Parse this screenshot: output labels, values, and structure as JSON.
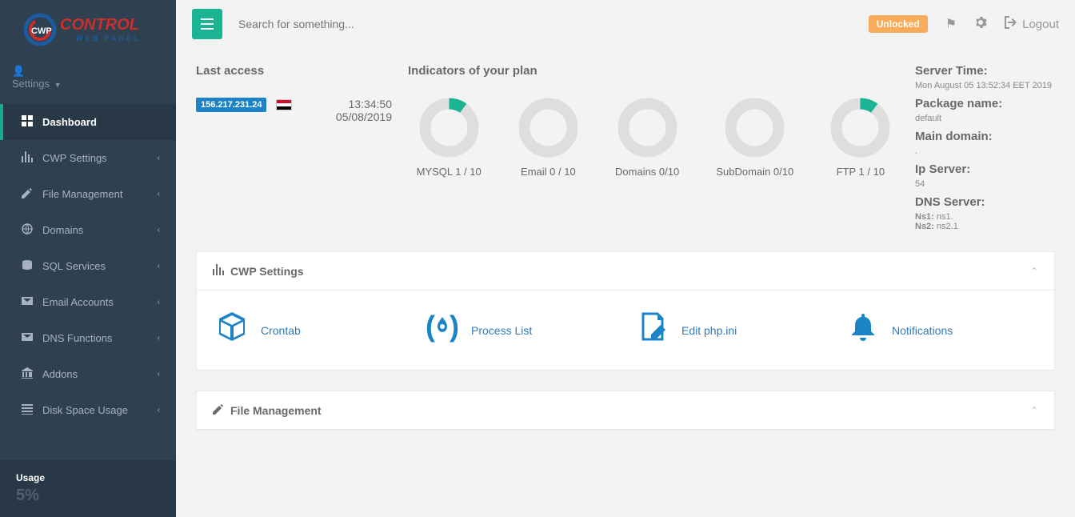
{
  "logo": {
    "top": "CWP",
    "main": "CONTROL",
    "sub": "WEB PANEL"
  },
  "settings_label": "Settings",
  "nav": [
    {
      "label": "Dashboard",
      "active": true,
      "icon": "grid"
    },
    {
      "label": "CWP Settings",
      "icon": "chart"
    },
    {
      "label": "File Management",
      "icon": "edit"
    },
    {
      "label": "Domains",
      "icon": "globe"
    },
    {
      "label": "SQL Services",
      "icon": "db"
    },
    {
      "label": "Email Accounts",
      "icon": "mail"
    },
    {
      "label": "DNS Functions",
      "icon": "mail"
    },
    {
      "label": "Addons",
      "icon": "bank"
    },
    {
      "label": "Disk Space Usage",
      "icon": "list"
    }
  ],
  "usage": {
    "label": "Usage",
    "percent": "5%"
  },
  "search": {
    "placeholder": "Search for something..."
  },
  "unlocked": "Unlocked",
  "logout": "Logout",
  "last_access": {
    "title": "Last access",
    "ip": "156.217.231.24",
    "time": "13:34:50",
    "date": "05/08/2019"
  },
  "indicators": {
    "title": "Indicators of your plan",
    "items": [
      {
        "label": "MYSQL 1 / 10",
        "used": 1,
        "total": 10
      },
      {
        "label": "Email 0 / 10",
        "used": 0,
        "total": 10
      },
      {
        "label": "Domains 0/10",
        "used": 0,
        "total": 10
      },
      {
        "label": "SubDomain 0/10",
        "used": 0,
        "total": 10
      },
      {
        "label": "FTP 1 / 10",
        "used": 1,
        "total": 10
      }
    ]
  },
  "server": {
    "time_label": "Server Time:",
    "time_value": "Mon August 05 13:52:34 EET 2019",
    "package_label": "Package name:",
    "package_value": "default",
    "domain_label": "Main domain:",
    "domain_value": ".",
    "ip_label": "Ip Server:",
    "ip_value": "54",
    "dns_label": "DNS Server:",
    "ns1_label": "Ns1:",
    "ns1_value": "ns1.",
    "ns2_label": "Ns2:",
    "ns2_value": "ns2.1"
  },
  "cwp_settings": {
    "title": "CWP Settings",
    "tiles": [
      {
        "label": "Crontab",
        "icon": "cube"
      },
      {
        "label": "Process List",
        "icon": "fire"
      },
      {
        "label": "Edit php.ini",
        "icon": "edit-doc"
      },
      {
        "label": "Notifications",
        "icon": "bell"
      }
    ]
  },
  "file_mgmt": {
    "title": "File Management"
  }
}
